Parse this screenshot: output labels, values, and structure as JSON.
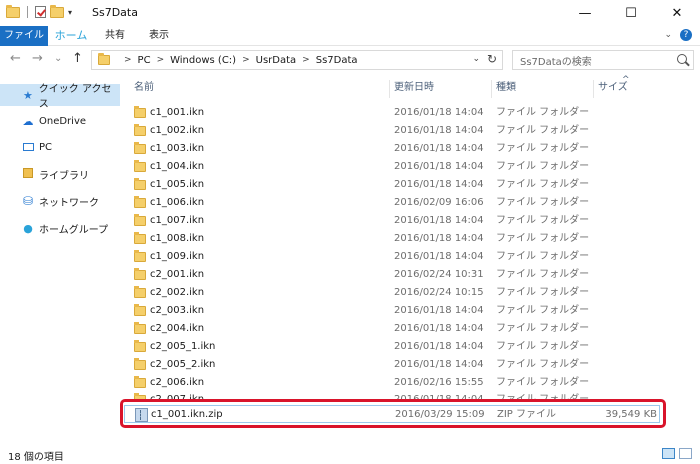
{
  "window": {
    "title": "Ss7Data",
    "qat_dropdown": "▾",
    "controls": {
      "minimize": "—",
      "maximize": "☐",
      "close": "✕"
    }
  },
  "ribbon": {
    "tabs": [
      {
        "label": "ファイル",
        "active": true
      },
      {
        "label": "ホーム"
      },
      {
        "label": "共有"
      },
      {
        "label": "表示"
      }
    ],
    "expand_glyph": "⌄",
    "help_glyph": "?"
  },
  "nav": {
    "back": "←",
    "forward": "→",
    "recent": "⌄",
    "up": "↑"
  },
  "address": {
    "crumbs": [
      "PC",
      "Windows (C:)",
      "UsrData",
      "Ss7Data"
    ],
    "separator": ">",
    "dropdown": "⌄",
    "refresh": "↻"
  },
  "search": {
    "placeholder": "Ss7Dataの検索"
  },
  "sidebar": {
    "items": [
      {
        "label": "クイック アクセス",
        "icon": "star-icon",
        "selected": true
      },
      {
        "label": "OneDrive",
        "icon": "cloud-icon"
      },
      {
        "label": "PC",
        "icon": "pc-icon"
      },
      {
        "label": "ライブラリ",
        "icon": "library-icon"
      },
      {
        "label": "ネットワーク",
        "icon": "network-icon"
      },
      {
        "label": "ホームグループ",
        "icon": "homegroup-icon"
      }
    ]
  },
  "columns": {
    "name": "名前",
    "date": "更新日時",
    "type": "種類",
    "size": "サイズ",
    "sort_glyph": "^"
  },
  "files": [
    {
      "name": "c1_001.ikn",
      "date": "2016/01/18 14:04",
      "type": "ファイル フォルダー",
      "size": ""
    },
    {
      "name": "c1_002.ikn",
      "date": "2016/01/18 14:04",
      "type": "ファイル フォルダー",
      "size": ""
    },
    {
      "name": "c1_003.ikn",
      "date": "2016/01/18 14:04",
      "type": "ファイル フォルダー",
      "size": ""
    },
    {
      "name": "c1_004.ikn",
      "date": "2016/01/18 14:04",
      "type": "ファイル フォルダー",
      "size": ""
    },
    {
      "name": "c1_005.ikn",
      "date": "2016/01/18 14:04",
      "type": "ファイル フォルダー",
      "size": ""
    },
    {
      "name": "c1_006.ikn",
      "date": "2016/02/09 16:06",
      "type": "ファイル フォルダー",
      "size": ""
    },
    {
      "name": "c1_007.ikn",
      "date": "2016/01/18 14:04",
      "type": "ファイル フォルダー",
      "size": ""
    },
    {
      "name": "c1_008.ikn",
      "date": "2016/01/18 14:04",
      "type": "ファイル フォルダー",
      "size": ""
    },
    {
      "name": "c1_009.ikn",
      "date": "2016/01/18 14:04",
      "type": "ファイル フォルダー",
      "size": ""
    },
    {
      "name": "c2_001.ikn",
      "date": "2016/02/24 10:31",
      "type": "ファイル フォルダー",
      "size": ""
    },
    {
      "name": "c2_002.ikn",
      "date": "2016/02/24 10:15",
      "type": "ファイル フォルダー",
      "size": ""
    },
    {
      "name": "c2_003.ikn",
      "date": "2016/01/18 14:04",
      "type": "ファイル フォルダー",
      "size": ""
    },
    {
      "name": "c2_004.ikn",
      "date": "2016/01/18 14:04",
      "type": "ファイル フォルダー",
      "size": ""
    },
    {
      "name": "c2_005_1.ikn",
      "date": "2016/01/18 14:04",
      "type": "ファイル フォルダー",
      "size": ""
    },
    {
      "name": "c2_005_2.ikn",
      "date": "2016/01/18 14:04",
      "type": "ファイル フォルダー",
      "size": ""
    },
    {
      "name": "c2_006.ikn",
      "date": "2016/02/16 15:55",
      "type": "ファイル フォルダー",
      "size": ""
    },
    {
      "name": "c2_007.ikn",
      "date": "2016/01/18 14:04",
      "type": "ファイル フォルダー",
      "size": ""
    },
    {
      "name": "c1_001.ikn.zip",
      "date": "2016/03/29 15:09",
      "type": "ZIP ファイル",
      "size": "39,549 KB"
    }
  ],
  "status": {
    "count": "18 個の項目"
  },
  "colors": {
    "accent": "#1a6fc4",
    "highlight": "#d9142b",
    "selection": "#cce4f7"
  }
}
